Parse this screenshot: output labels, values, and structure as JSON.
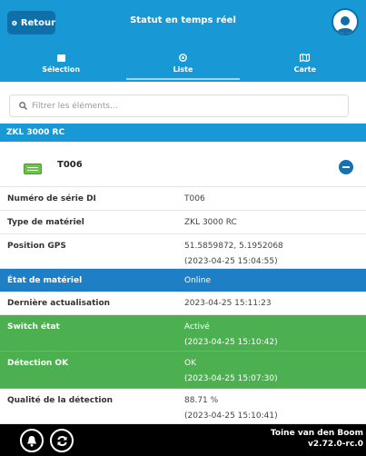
{
  "header": {
    "back_label": "Retour",
    "title": "Statut en temps réel",
    "avatar_icon": "user-icon"
  },
  "tabs": [
    {
      "label": "Sélection",
      "icon": "square-icon"
    },
    {
      "label": "Liste",
      "icon": "target-icon",
      "active": true
    },
    {
      "label": "Carte",
      "icon": "map-icon"
    }
  ],
  "search": {
    "placeholder": "Filtrer les éléments..."
  },
  "group": {
    "title": "ZKL 3000 RC"
  },
  "device": {
    "name": "T006"
  },
  "details": [
    {
      "label": "Numéro de série DI",
      "value": "T006",
      "value2": ""
    },
    {
      "label": "Type de matériel",
      "value": "ZKL 3000 RC",
      "value2": ""
    },
    {
      "label": "Position GPS",
      "value": "51.5859872, 5.1952068",
      "value2": "(2023-04-25 15:04:55)"
    },
    {
      "label": "État de matériel",
      "value": "Online",
      "value2": ""
    },
    {
      "label": "Dernière actualisation",
      "value": "2023-04-25 15:11:23",
      "value2": ""
    },
    {
      "label": "Switch état",
      "value": "Activé",
      "value2": "(2023-04-25 15:10:42)"
    },
    {
      "label": "Détection OK",
      "value": "OK",
      "value2": "(2023-04-25 15:07:30)"
    },
    {
      "label": "Qualité de la détection",
      "value": "88.71 %",
      "value2": "(2023-04-25 15:10:41)"
    }
  ],
  "footer": {
    "user": "Toine van den Boom",
    "version": "v2.72.0-rc.0"
  },
  "colors": {
    "primary": "#1899d6",
    "status_blue": "#1f7fc4",
    "status_green": "#4cb050",
    "footer": "#000000"
  }
}
